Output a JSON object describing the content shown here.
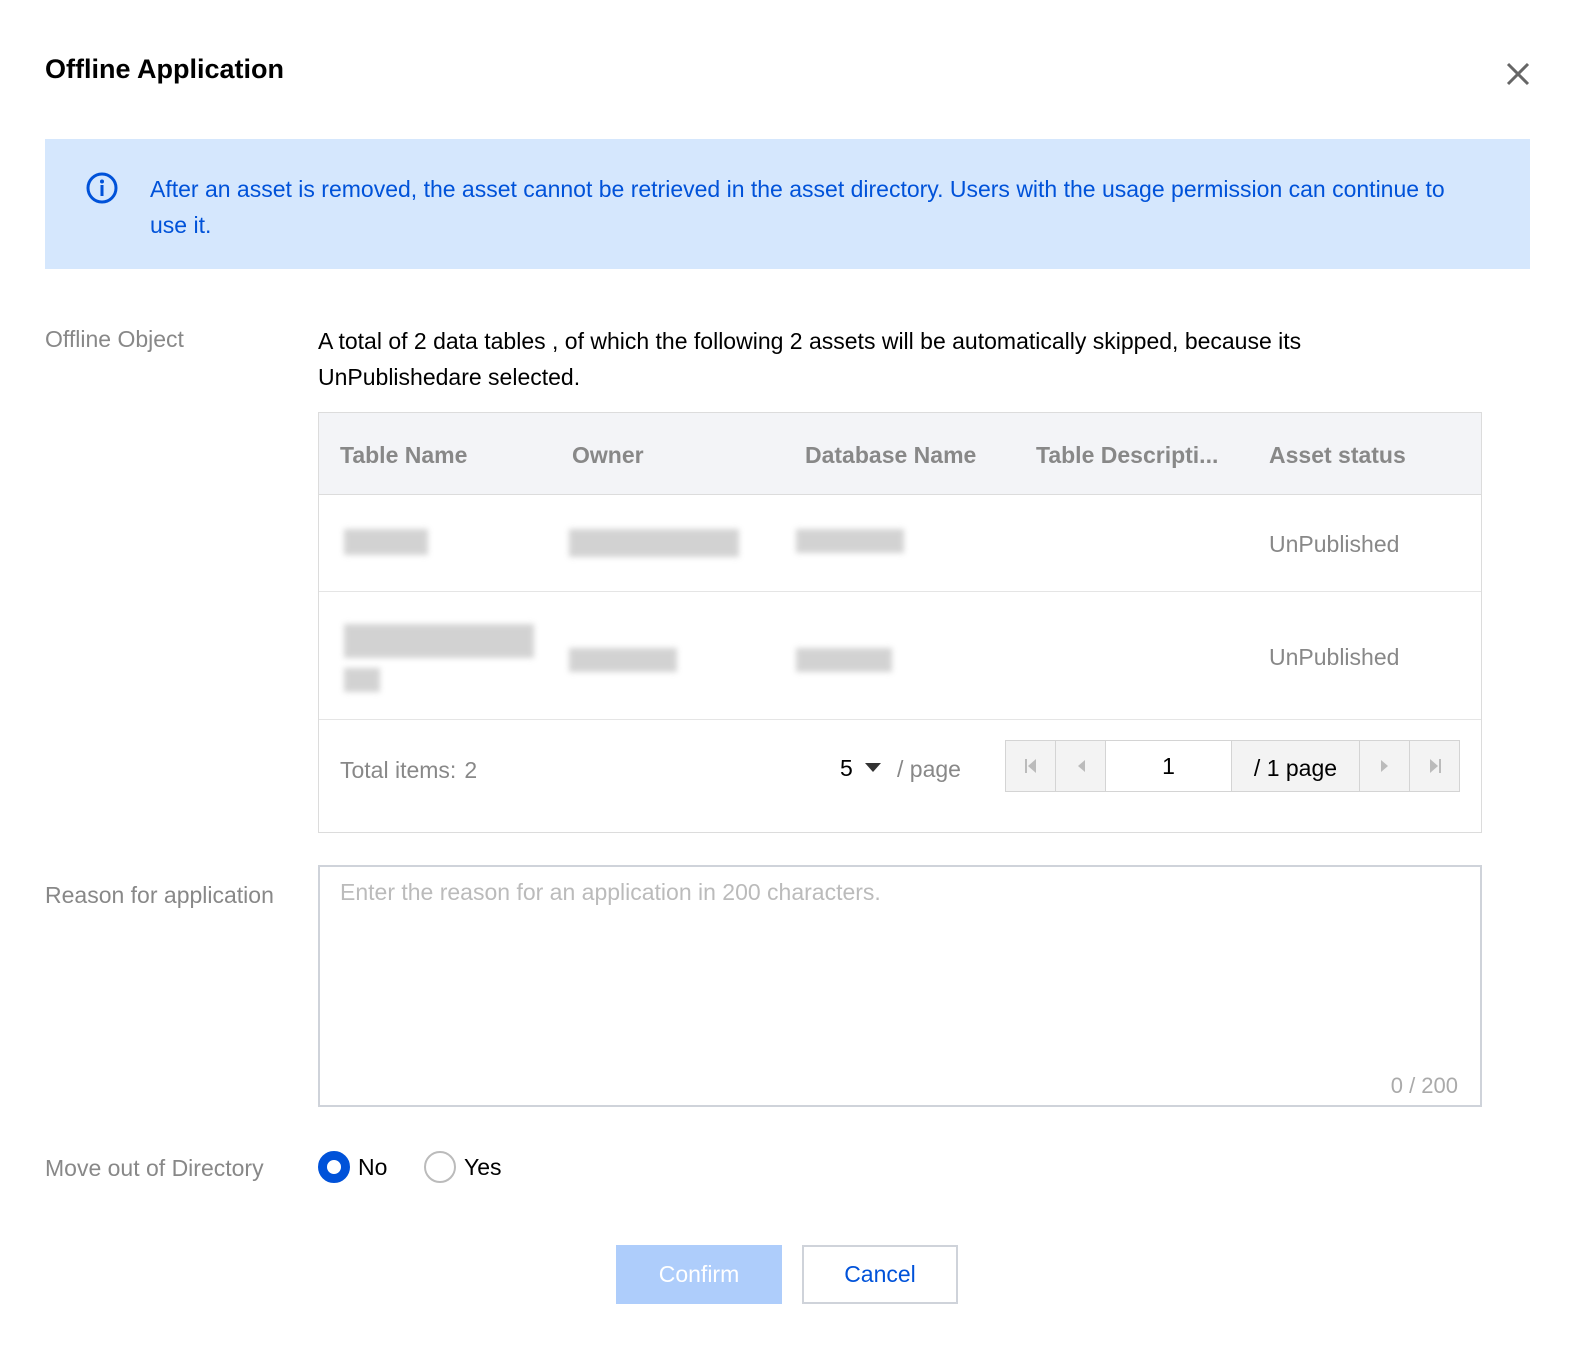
{
  "dialog": {
    "title": "Offline Application"
  },
  "alert": {
    "text": "After an asset is removed, the asset cannot be retrieved in the asset directory. Users with the usage permission can continue to use it."
  },
  "labels": {
    "offline_object": "Offline Object",
    "reason": "Reason for application",
    "move_out": "Move out of Directory"
  },
  "offline_object_desc": "A total of 2 data tables , of which the following 2 assets will be automatically skipped, because its UnPublishedare selected.",
  "table": {
    "columns": [
      "Table Name",
      "Owner",
      "Database Name",
      "Table Descripti...",
      "Asset status"
    ],
    "rows": [
      {
        "asset_status": "UnPublished"
      },
      {
        "asset_status": "UnPublished"
      }
    ]
  },
  "pagination": {
    "total_label": "Total items:",
    "total_value": "2",
    "page_size": "5",
    "per_page_label": "/ page",
    "current_page": "1",
    "total_pages_label": "/ 1 page"
  },
  "reason": {
    "placeholder": "Enter the reason for an application in 200 characters.",
    "counter": "0 / 200"
  },
  "move_out": {
    "options": [
      "No",
      "Yes"
    ],
    "selected": "No"
  },
  "buttons": {
    "confirm": "Confirm",
    "cancel": "Cancel"
  },
  "colors": {
    "primary": "#0052d9",
    "alert_bg": "#d5e7fd",
    "confirm_disabled": "#aecdfb"
  },
  "icons": {
    "close": "close-icon",
    "info": "info-icon"
  }
}
